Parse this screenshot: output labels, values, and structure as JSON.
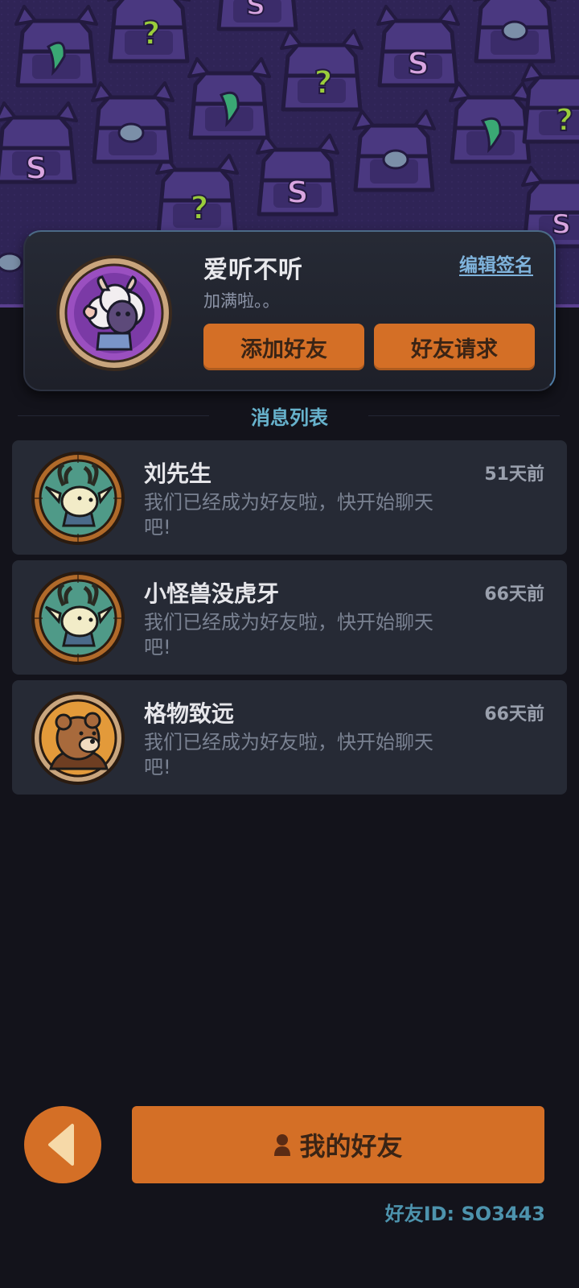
{
  "profile": {
    "name": "爱听不听",
    "signature": "加满啦。。",
    "edit_signature_label": "编辑签名",
    "add_friend_label": "添加好友",
    "friend_request_label": "好友请求",
    "avatar_icon": "sheep-avatar-icon"
  },
  "section_title": "消息列表",
  "messages": [
    {
      "name": "刘先生",
      "preview": "我们已经成为好友啦，快开始聊天吧!",
      "time": "51天前",
      "avatar_icon": "deer-avatar-icon"
    },
    {
      "name": "小怪兽没虎牙",
      "preview": "我们已经成为好友啦，快开始聊天吧!",
      "time": "66天前",
      "avatar_icon": "deer-avatar-icon"
    },
    {
      "name": "格物致远",
      "preview": "我们已经成为好友啦，快开始聊天吧!",
      "time": "66天前",
      "avatar_icon": "bear-avatar-icon"
    }
  ],
  "bottom": {
    "my_friends_label": "我的好友",
    "friend_id_text": "好友ID: SO3443",
    "back_icon": "back-arrow-icon",
    "person_icon": "person-icon"
  },
  "colors": {
    "accent_orange": "#d46f26",
    "background": "#13131b",
    "card": "#262a35",
    "banner": "#2f2456",
    "section_title": "#67b2cc"
  }
}
